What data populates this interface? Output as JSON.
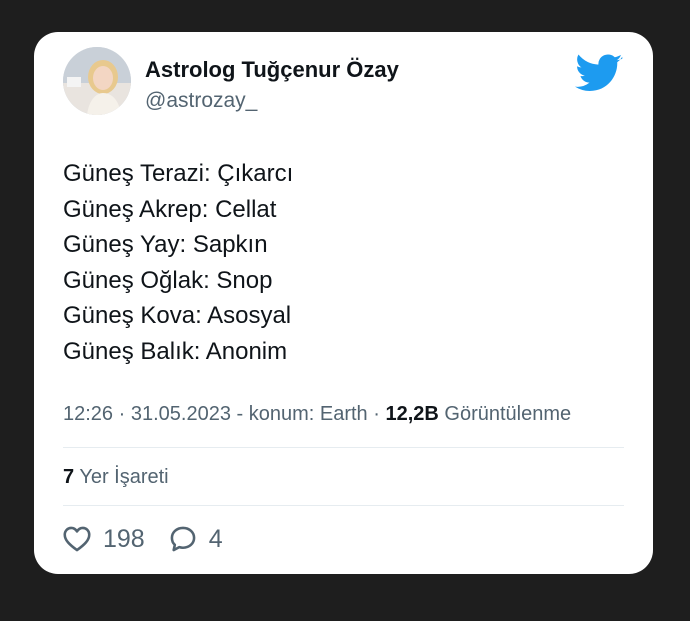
{
  "author": {
    "name": "Astrolog Tuğçenur Özay",
    "handle": "@astrozay_"
  },
  "tweet": {
    "lines": [
      "Güneş Terazi: Çıkarcı",
      "Güneş Akrep: Cellat",
      "Güneş Yay: Sapkın",
      "Güneş Oğlak: Snop",
      "Güneş Kova: Asosyal",
      "Güneş Balık: Anonim"
    ]
  },
  "meta": {
    "time": "12:26",
    "sep1": " · ",
    "date": "31.05.2023",
    "location_text": " - konum: Earth",
    "sep2": " · ",
    "views_count": "12,2B",
    "views_label": " Görüntülenme"
  },
  "bookmarks": {
    "count": "7",
    "label": " Yer İşareti"
  },
  "actions": {
    "likes": "198",
    "replies": "4"
  },
  "colors": {
    "twitter_blue": "#1d9bf0",
    "text": "#0f1419",
    "muted": "#536471",
    "background": "#1e1e1e"
  },
  "icons": [
    "twitter-bird-icon",
    "heart-icon",
    "reply-icon"
  ]
}
